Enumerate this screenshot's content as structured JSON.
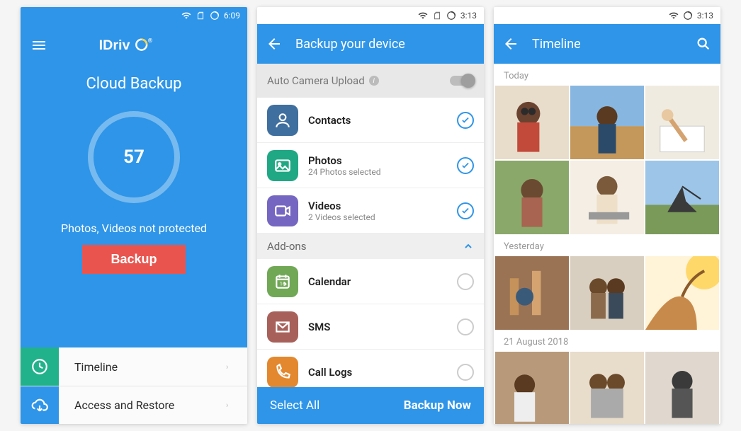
{
  "status_time_1": "6:09",
  "status_time_2": "3:13",
  "status_time_3": "3:13",
  "s1": {
    "logo_text": "IDriv",
    "title": "Cloud Backup",
    "count": "57",
    "warning": "Photos, Videos not protected",
    "backup_btn": "Backup",
    "nav": {
      "timeline": "Timeline",
      "access": "Access and Restore"
    }
  },
  "s2": {
    "header_title": "Backup your device",
    "auto_label": "Auto Camera Upload",
    "addons_label": "Add-ons",
    "items": [
      {
        "title": "Contacts",
        "sub": "",
        "checked": true
      },
      {
        "title": "Photos",
        "sub": "24 Photos selected",
        "checked": true
      },
      {
        "title": "Videos",
        "sub": "2 Videos selected",
        "checked": true
      }
    ],
    "addons": [
      {
        "title": "Calendar",
        "checked": false
      },
      {
        "title": "SMS",
        "checked": false
      },
      {
        "title": "Call Logs",
        "checked": false
      }
    ],
    "footer_left": "Select All",
    "footer_right": "Backup Now"
  },
  "s3": {
    "header_title": "Timeline",
    "section_today": "Today",
    "section_yesterday": "Yesterday",
    "section_date": "21 August 2018"
  }
}
